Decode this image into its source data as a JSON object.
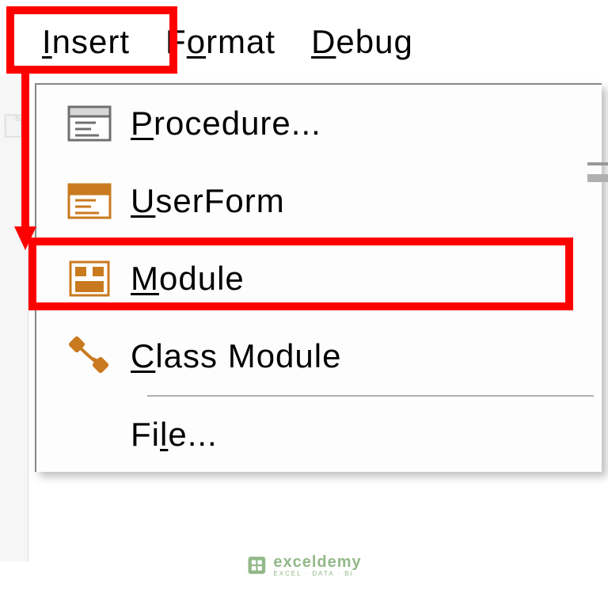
{
  "menubar": {
    "insert": {
      "prefix": "I",
      "rest": "nsert"
    },
    "format": {
      "prefix": "F",
      "rest": "ormat",
      "u_index": 1
    },
    "debug": {
      "prefix": "D",
      "rest": "ebug"
    }
  },
  "dropdown": {
    "procedure": {
      "prefix": "P",
      "rest": "rocedure...",
      "icon": "procedure-icon"
    },
    "userform": {
      "prefix": "U",
      "rest": "serForm",
      "icon": "userform-icon"
    },
    "module": {
      "prefix": "M",
      "rest": "odule",
      "icon": "module-icon"
    },
    "classmodule": {
      "prefix": "C",
      "rest": "lass Module",
      "icon": "classmodule-icon"
    },
    "file": {
      "prefix": "F",
      "rest": "ile...",
      "icon": ""
    }
  },
  "watermark": {
    "brand": "exceldemy",
    "tagline": "EXCEL · DATA · BI"
  },
  "colors": {
    "highlight": "#ff0000",
    "iconOrange": "#c97a1f",
    "iconGray": "#707070"
  },
  "highlighted": {
    "menu": "insert",
    "item": "module"
  }
}
